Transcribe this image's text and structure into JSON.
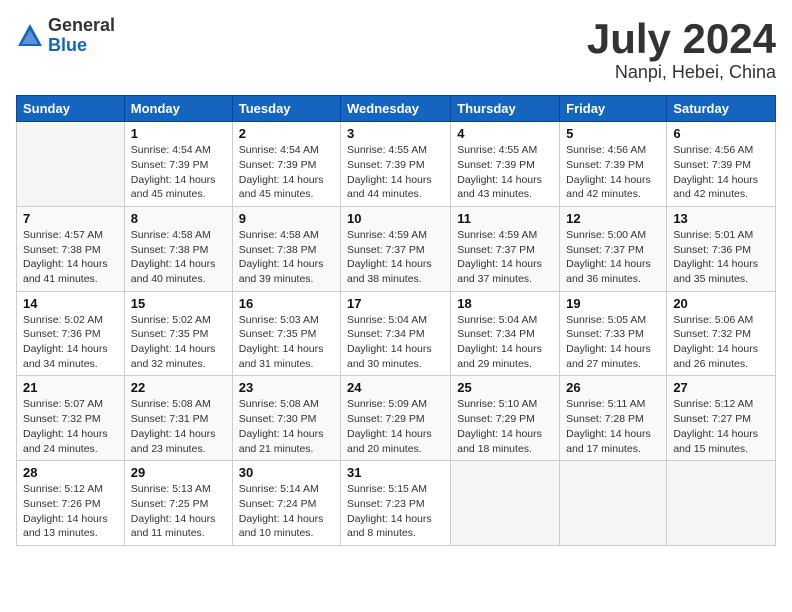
{
  "header": {
    "logo_general": "General",
    "logo_blue": "Blue",
    "month": "July 2024",
    "location": "Nanpi, Hebei, China"
  },
  "weekdays": [
    "Sunday",
    "Monday",
    "Tuesday",
    "Wednesday",
    "Thursday",
    "Friday",
    "Saturday"
  ],
  "weeks": [
    [
      {
        "day": "",
        "info": ""
      },
      {
        "day": "1",
        "info": "Sunrise: 4:54 AM\nSunset: 7:39 PM\nDaylight: 14 hours\nand 45 minutes."
      },
      {
        "day": "2",
        "info": "Sunrise: 4:54 AM\nSunset: 7:39 PM\nDaylight: 14 hours\nand 45 minutes."
      },
      {
        "day": "3",
        "info": "Sunrise: 4:55 AM\nSunset: 7:39 PM\nDaylight: 14 hours\nand 44 minutes."
      },
      {
        "day": "4",
        "info": "Sunrise: 4:55 AM\nSunset: 7:39 PM\nDaylight: 14 hours\nand 43 minutes."
      },
      {
        "day": "5",
        "info": "Sunrise: 4:56 AM\nSunset: 7:39 PM\nDaylight: 14 hours\nand 42 minutes."
      },
      {
        "day": "6",
        "info": "Sunrise: 4:56 AM\nSunset: 7:39 PM\nDaylight: 14 hours\nand 42 minutes."
      }
    ],
    [
      {
        "day": "7",
        "info": "Sunrise: 4:57 AM\nSunset: 7:38 PM\nDaylight: 14 hours\nand 41 minutes."
      },
      {
        "day": "8",
        "info": "Sunrise: 4:58 AM\nSunset: 7:38 PM\nDaylight: 14 hours\nand 40 minutes."
      },
      {
        "day": "9",
        "info": "Sunrise: 4:58 AM\nSunset: 7:38 PM\nDaylight: 14 hours\nand 39 minutes."
      },
      {
        "day": "10",
        "info": "Sunrise: 4:59 AM\nSunset: 7:37 PM\nDaylight: 14 hours\nand 38 minutes."
      },
      {
        "day": "11",
        "info": "Sunrise: 4:59 AM\nSunset: 7:37 PM\nDaylight: 14 hours\nand 37 minutes."
      },
      {
        "day": "12",
        "info": "Sunrise: 5:00 AM\nSunset: 7:37 PM\nDaylight: 14 hours\nand 36 minutes."
      },
      {
        "day": "13",
        "info": "Sunrise: 5:01 AM\nSunset: 7:36 PM\nDaylight: 14 hours\nand 35 minutes."
      }
    ],
    [
      {
        "day": "14",
        "info": "Sunrise: 5:02 AM\nSunset: 7:36 PM\nDaylight: 14 hours\nand 34 minutes."
      },
      {
        "day": "15",
        "info": "Sunrise: 5:02 AM\nSunset: 7:35 PM\nDaylight: 14 hours\nand 32 minutes."
      },
      {
        "day": "16",
        "info": "Sunrise: 5:03 AM\nSunset: 7:35 PM\nDaylight: 14 hours\nand 31 minutes."
      },
      {
        "day": "17",
        "info": "Sunrise: 5:04 AM\nSunset: 7:34 PM\nDaylight: 14 hours\nand 30 minutes."
      },
      {
        "day": "18",
        "info": "Sunrise: 5:04 AM\nSunset: 7:34 PM\nDaylight: 14 hours\nand 29 minutes."
      },
      {
        "day": "19",
        "info": "Sunrise: 5:05 AM\nSunset: 7:33 PM\nDaylight: 14 hours\nand 27 minutes."
      },
      {
        "day": "20",
        "info": "Sunrise: 5:06 AM\nSunset: 7:32 PM\nDaylight: 14 hours\nand 26 minutes."
      }
    ],
    [
      {
        "day": "21",
        "info": "Sunrise: 5:07 AM\nSunset: 7:32 PM\nDaylight: 14 hours\nand 24 minutes."
      },
      {
        "day": "22",
        "info": "Sunrise: 5:08 AM\nSunset: 7:31 PM\nDaylight: 14 hours\nand 23 minutes."
      },
      {
        "day": "23",
        "info": "Sunrise: 5:08 AM\nSunset: 7:30 PM\nDaylight: 14 hours\nand 21 minutes."
      },
      {
        "day": "24",
        "info": "Sunrise: 5:09 AM\nSunset: 7:29 PM\nDaylight: 14 hours\nand 20 minutes."
      },
      {
        "day": "25",
        "info": "Sunrise: 5:10 AM\nSunset: 7:29 PM\nDaylight: 14 hours\nand 18 minutes."
      },
      {
        "day": "26",
        "info": "Sunrise: 5:11 AM\nSunset: 7:28 PM\nDaylight: 14 hours\nand 17 minutes."
      },
      {
        "day": "27",
        "info": "Sunrise: 5:12 AM\nSunset: 7:27 PM\nDaylight: 14 hours\nand 15 minutes."
      }
    ],
    [
      {
        "day": "28",
        "info": "Sunrise: 5:12 AM\nSunset: 7:26 PM\nDaylight: 14 hours\nand 13 minutes."
      },
      {
        "day": "29",
        "info": "Sunrise: 5:13 AM\nSunset: 7:25 PM\nDaylight: 14 hours\nand 11 minutes."
      },
      {
        "day": "30",
        "info": "Sunrise: 5:14 AM\nSunset: 7:24 PM\nDaylight: 14 hours\nand 10 minutes."
      },
      {
        "day": "31",
        "info": "Sunrise: 5:15 AM\nSunset: 7:23 PM\nDaylight: 14 hours\nand 8 minutes."
      },
      {
        "day": "",
        "info": ""
      },
      {
        "day": "",
        "info": ""
      },
      {
        "day": "",
        "info": ""
      }
    ]
  ]
}
